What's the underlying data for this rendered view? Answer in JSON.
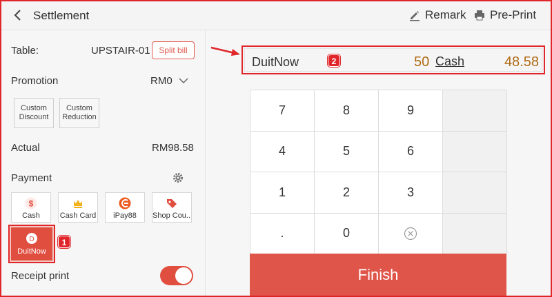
{
  "header": {
    "title": "Settlement",
    "remark_label": "Remark",
    "preprint_label": "Pre-Print"
  },
  "left": {
    "table_label": "Table:",
    "table_value": "UPSTAIR-01",
    "split_bill_label": "Split bill",
    "promotion_label": "Promotion",
    "promotion_value": "RM0",
    "custom_discount": "Custom Discount",
    "custom_reduction": "Custom Reduction",
    "actual_label": "Actual",
    "actual_value": "RM98.58",
    "payment_label": "Payment",
    "payment_methods": [
      "Cash",
      "Cash Card",
      "iPay88",
      "Shop Cou..."
    ],
    "selected_method": "DuitNow",
    "receipt_print_label": "Receipt print",
    "receipt_print_on": true
  },
  "right": {
    "method_name": "DuitNow",
    "amount": "50",
    "cash_label": "Cash",
    "change": "48.58",
    "keys": [
      "7",
      "8",
      "9",
      "",
      "4",
      "5",
      "6",
      "",
      "1",
      "2",
      "3",
      "",
      ".",
      "0",
      "",
      ""
    ],
    "finish_label": "Finish"
  },
  "annotations": {
    "badge_1": "1",
    "badge_2": "2"
  },
  "colors": {
    "accent": "#e04e40",
    "highlight": "#e0262b",
    "amount": "#b06a14"
  }
}
